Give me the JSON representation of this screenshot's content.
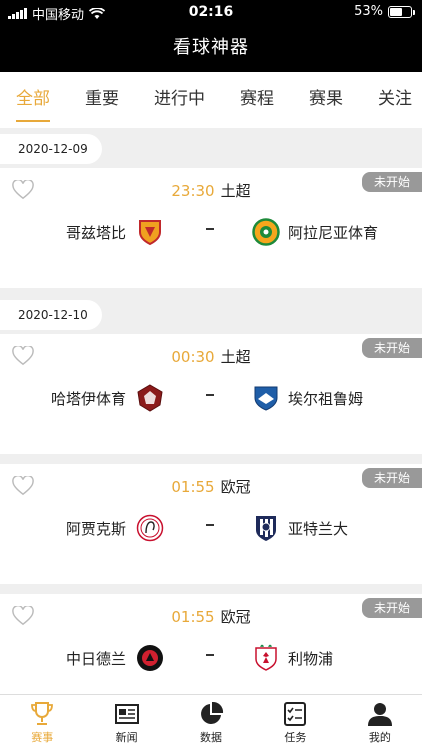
{
  "status_bar": {
    "carrier": "中国移动",
    "time": "02:16",
    "battery": "53%"
  },
  "nav": {
    "title": "看球神器"
  },
  "tabs": [
    {
      "label": "全部",
      "active": true
    },
    {
      "label": "重要",
      "active": false
    },
    {
      "label": "进行中",
      "active": false
    },
    {
      "label": "赛程",
      "active": false
    },
    {
      "label": "赛果",
      "active": false
    },
    {
      "label": "关注",
      "active": false
    }
  ],
  "dates": [
    "2020-12-09",
    "2020-12-10"
  ],
  "matches": [
    {
      "time": "23:30",
      "league": "土超",
      "home": "哥兹塔比",
      "away": "阿拉尼亚体育",
      "status": "未开始"
    },
    {
      "time": "00:30",
      "league": "土超",
      "home": "哈塔伊体育",
      "away": "埃尔祖鲁姆",
      "status": "未开始"
    },
    {
      "time": "01:55",
      "league": "欧冠",
      "home": "阿贾克斯",
      "away": "亚特兰大",
      "status": "未开始"
    },
    {
      "time": "01:55",
      "league": "欧冠",
      "home": "中日德兰",
      "away": "利物浦",
      "status": "未开始"
    }
  ],
  "tabbar": [
    {
      "label": "赛事",
      "icon": "trophy-icon",
      "active": true
    },
    {
      "label": "新闻",
      "icon": "newspaper-icon",
      "active": false
    },
    {
      "label": "数据",
      "icon": "pie-chart-icon",
      "active": false
    },
    {
      "label": "任务",
      "icon": "checklist-icon",
      "active": false
    },
    {
      "label": "我的",
      "icon": "user-icon",
      "active": false
    }
  ],
  "colors": {
    "accent": "#e8a93a",
    "header": "#000000",
    "badge": "#999999"
  }
}
